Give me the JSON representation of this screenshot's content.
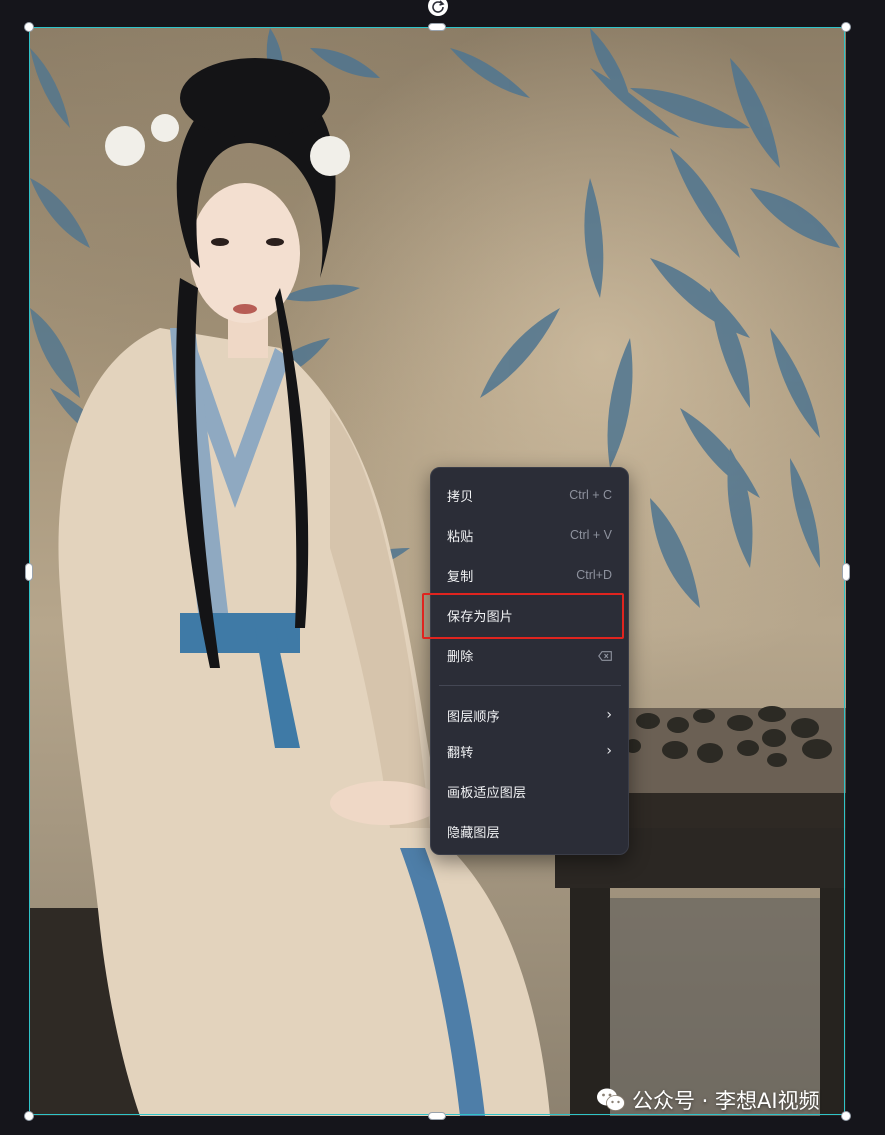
{
  "context_menu": {
    "items": [
      {
        "label": "拷贝",
        "shortcut": "Ctrl + C"
      },
      {
        "label": "粘贴",
        "shortcut": "Ctrl + V"
      },
      {
        "label": "复制",
        "shortcut": "Ctrl+D"
      },
      {
        "label": "保存为图片",
        "shortcut": ""
      },
      {
        "label": "删除",
        "shortcut_icon": "backspace-icon"
      },
      {
        "label": "图层顺序",
        "submenu": true
      },
      {
        "label": "翻转",
        "submenu": true
      },
      {
        "label": "画板适应图层"
      },
      {
        "label": "隐藏图层"
      }
    ],
    "submenu_arrow": "›",
    "highlighted_item": "保存为图片"
  },
  "watermark": {
    "text": "公众号 · 李想AI视频",
    "logo_icon": "wechat-icon"
  },
  "selection": {
    "rotate_icon": "rotate-icon",
    "frame_color": "#2fc3c9"
  },
  "colors": {
    "menu_bg": "#2b2d37",
    "highlight_border": "#e0241f",
    "canvas_bg": "#15151b"
  }
}
